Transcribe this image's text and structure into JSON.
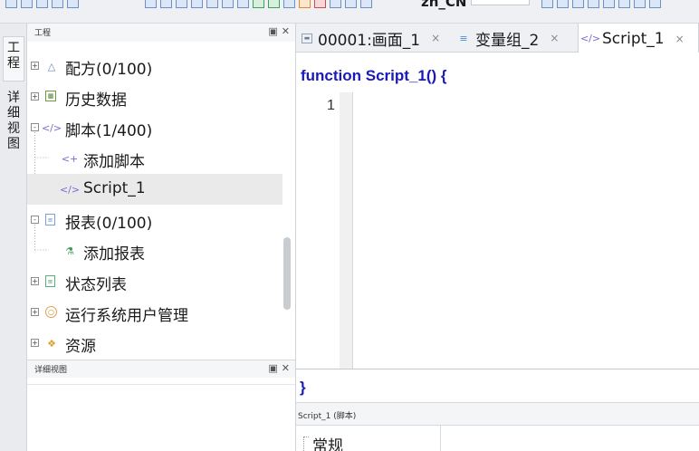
{
  "toolbar": {
    "language": "zh_CN"
  },
  "side_tabs": {
    "project": "工程",
    "detail_view": "详细视图"
  },
  "project_panel": {
    "title": "工程",
    "float_icon": "float-icon",
    "close_icon": "close-icon",
    "tree": [
      {
        "label": "配方(0/100)",
        "icon": "flask-icon",
        "expander": "+"
      },
      {
        "label": "历史数据",
        "icon": "history-data-icon",
        "expander": "+"
      },
      {
        "label": "脚本(1/400)",
        "icon": "script-icon",
        "expander": "-"
      },
      {
        "label": "添加脚本",
        "icon": "add-script-icon"
      },
      {
        "label": "Script_1",
        "icon": "script-icon"
      },
      {
        "label": "报表(0/100)",
        "icon": "report-icon",
        "expander": "-"
      },
      {
        "label": "添加报表",
        "icon": "add-report-icon"
      },
      {
        "label": "状态列表",
        "icon": "status-list-icon",
        "expander": "+"
      },
      {
        "label": "运行系统用户管理",
        "icon": "user-management-icon",
        "expander": "+"
      },
      {
        "label": "资源",
        "icon": "resource-icon",
        "expander": "+"
      }
    ]
  },
  "detail_panel": {
    "title": "详细视图"
  },
  "doc_tabs": [
    {
      "label": "00001:画面_1",
      "icon": "screen-icon",
      "close": "×"
    },
    {
      "label": "变量组_2",
      "icon": "tag-group-icon",
      "close": "×"
    },
    {
      "label": "Script_1",
      "icon": "script-icon",
      "close": "×",
      "active": true
    }
  ],
  "editor": {
    "header": "function Script_1() {",
    "line_number": "1",
    "footer": "}"
  },
  "properties": {
    "title": "Script_1 (脚本)",
    "category": "常规"
  },
  "colors": {
    "keyword_blue": "#1a1ab8",
    "selection_gray": "#eaeaea",
    "panel_bg": "#eef0f3"
  }
}
